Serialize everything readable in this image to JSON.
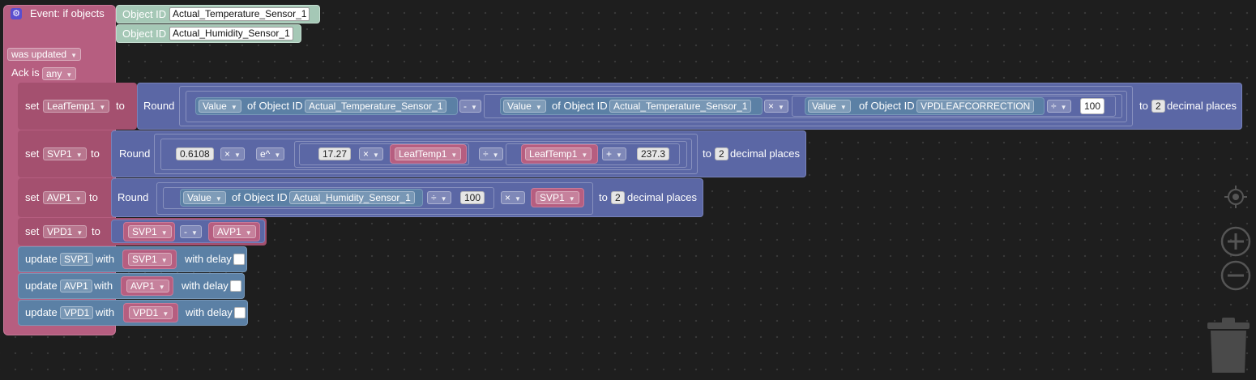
{
  "event": {
    "title": "Event: if objects",
    "object_id_label": "Object ID",
    "objects": [
      "Actual_Temperature_Sensor_1",
      "Actual_Humidity_Sensor_1"
    ],
    "trigger": "was updated",
    "ack_label": "Ack is",
    "ack_value": "any"
  },
  "common": {
    "set": "set",
    "to": "to",
    "round": "Round",
    "to2": "to",
    "decimal_places": "decimal places",
    "value": "Value",
    "of_object_id": "of Object ID",
    "update": "update",
    "with": "with",
    "with_delay": "with delay"
  },
  "set_leaftemp": {
    "var": "LeafTemp1",
    "obj1": "Actual_Temperature_Sensor_1",
    "op1": "-",
    "obj2": "Actual_Temperature_Sensor_1",
    "op2": "×",
    "obj3": "VPDLEAFCORRECTION",
    "op3": "÷",
    "divisor": "100",
    "decimals": "2"
  },
  "set_svp": {
    "var": "SVP1",
    "coef": "0.6108",
    "op1": "×",
    "func": "e^",
    "k": "17.27",
    "op2": "×",
    "var_a": "LeafTemp1",
    "op3": "÷",
    "var_b": "LeafTemp1",
    "op4": "+",
    "add": "237.3",
    "decimals": "2"
  },
  "set_avp": {
    "var": "AVP1",
    "obj": "Actual_Humidity_Sensor_1",
    "op1": "÷",
    "divisor": "100",
    "op2": "×",
    "var_b": "SVP1",
    "decimals": "2"
  },
  "set_vpd": {
    "var": "VPD1",
    "a": "SVP1",
    "op": "-",
    "b": "AVP1"
  },
  "updates": [
    {
      "state": "SVP1",
      "value": "SVP1"
    },
    {
      "state": "AVP1",
      "value": "AVP1"
    },
    {
      "state": "VPD1",
      "value": "VPD1"
    }
  ],
  "colors": {
    "event": "#b65e80",
    "math": "#5b67a5",
    "variable": "#b65e80",
    "update": "#5b80a5",
    "object_id": "#a5c8b6",
    "background": "#1e1e1e"
  }
}
